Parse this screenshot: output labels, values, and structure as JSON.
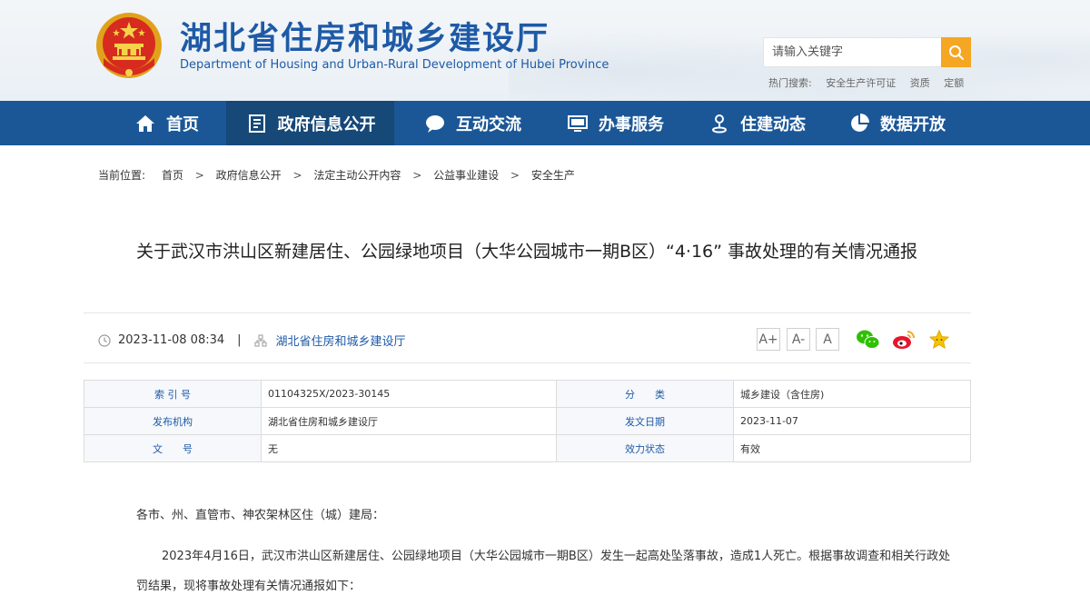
{
  "header": {
    "title": "湖北省住房和城乡建设厅",
    "subtitle": "Department of Housing and Urban-Rural Development of Hubei Province",
    "search_placeholder": "请输入关键字",
    "hot_label": "热门搜索:",
    "hot_links": [
      "安全生产许可证",
      "资质",
      "定额"
    ],
    "accent_color": "#1e5aa6",
    "search_button_color": "#f5a623"
  },
  "nav": {
    "items": [
      {
        "label": "首页",
        "icon": "home-icon"
      },
      {
        "label": "政府信息公开",
        "icon": "document-list-icon"
      },
      {
        "label": "互动交流",
        "icon": "chat-bubble-icon"
      },
      {
        "label": "办事服务",
        "icon": "monitor-icon"
      },
      {
        "label": "住建动态",
        "icon": "location-person-icon"
      },
      {
        "label": "数据开放",
        "icon": "pie-chart-icon"
      }
    ],
    "active_index": 1,
    "bar_color": "#1b5797"
  },
  "breadcrumb": {
    "label": "当前位置:",
    "items": [
      "首页",
      "政府信息公开",
      "法定主动公开内容",
      "公益事业建设",
      "安全生产"
    ]
  },
  "article": {
    "title": "关于武汉市洪山区新建居住、公园绿地项目（大华公园城市一期B区）“4·16” 事故处理的有关情况通报",
    "date": "2023-11-08 08:34",
    "separator": "|",
    "source": "湖北省住房和城乡建设厅",
    "font_buttons": [
      "A+",
      "A-",
      "A"
    ],
    "share_icons": [
      "wechat-icon",
      "weibo-icon",
      "favorite-star-icon"
    ]
  },
  "info_table": {
    "rows": [
      [
        {
          "label": "索 引 号",
          "value": "01104325X/2023-30145"
        },
        {
          "label": "分　　类",
          "value": "城乡建设（含住房)"
        }
      ],
      [
        {
          "label": "发布机构",
          "value": "湖北省住房和城乡建设厅"
        },
        {
          "label": "发文日期",
          "value": "2023-11-07"
        }
      ],
      [
        {
          "label": "文　　号",
          "value": "无"
        },
        {
          "label": "效力状态",
          "value": "有效"
        }
      ]
    ]
  },
  "body": {
    "salutation": "各市、州、直管市、神农架林区住（城）建局：",
    "paragraph_line1": "2023年4月16日，武汉市洪山区新建居住、公园绿地项目（大华公园城市一期B区）发生一起高处坠落事故，造成1人死亡。根据事故调查和相关行政处",
    "paragraph_line2": "罚结果，现将事故处理有关情况通报如下："
  }
}
